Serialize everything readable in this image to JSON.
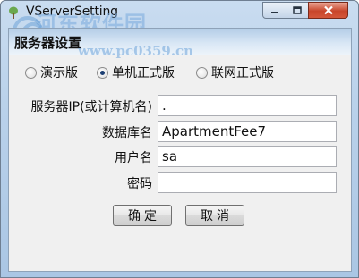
{
  "window": {
    "title": "VServerSetting",
    "watermark": "河东软件园",
    "watermark_url": "www.pc0359.cn",
    "controls": {
      "minimize_icon": "minimize-icon",
      "maximize_icon": "maximize-icon",
      "close_icon": "close-icon"
    }
  },
  "group": {
    "title": "服务器设置"
  },
  "mode": {
    "options": [
      "演示版",
      "单机正式版",
      "联网正式版"
    ],
    "selected": "单机正式版"
  },
  "form": {
    "server_ip": {
      "label": "服务器IP(或计算机名)",
      "value": "."
    },
    "database": {
      "label": "数据库名",
      "value": "ApartmentFee7"
    },
    "username": {
      "label": "用户名",
      "value": "sa"
    },
    "password": {
      "label": "密码",
      "value": ""
    }
  },
  "buttons": {
    "ok": "确定",
    "cancel": "取消"
  },
  "colors": {
    "title_bar": "#b9d1ea",
    "close_button": "#c8452a",
    "client_bg": "#f0f0f0"
  }
}
